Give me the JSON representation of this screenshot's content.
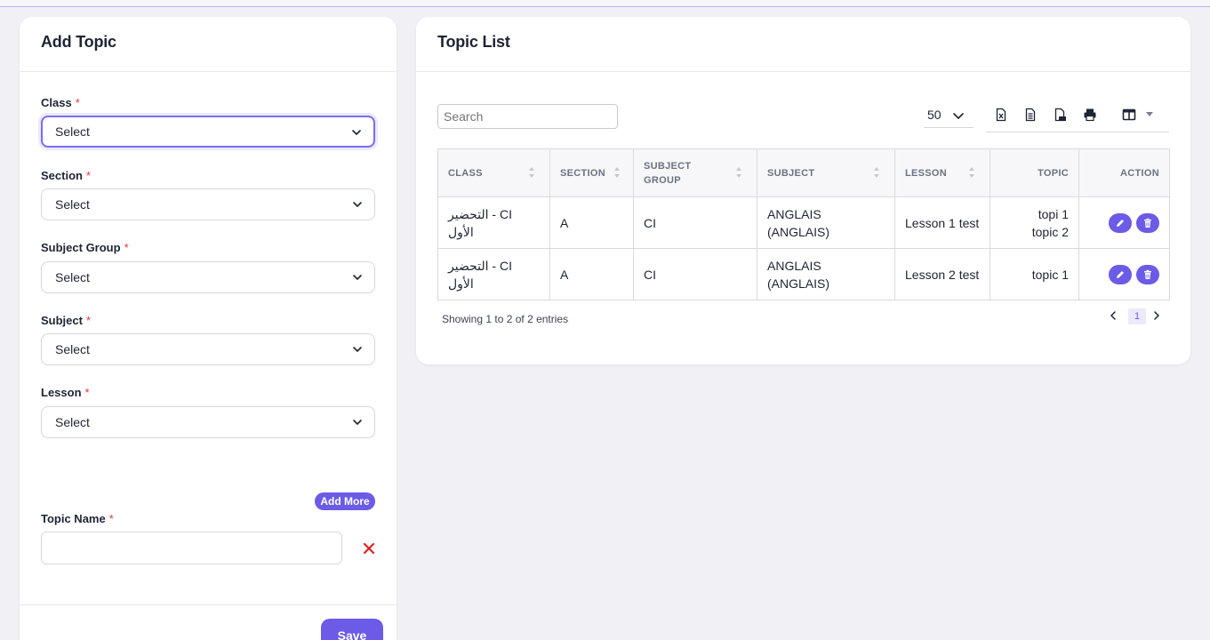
{
  "add_topic": {
    "title": "Add Topic",
    "required_mark": "*",
    "fields": [
      {
        "label": "Class",
        "value": "Select"
      },
      {
        "label": "Section",
        "value": "Select"
      },
      {
        "label": "Subject Group",
        "value": "Select"
      },
      {
        "label": "Subject",
        "value": "Select"
      },
      {
        "label": "Lesson",
        "value": "Select"
      }
    ],
    "add_more_label": "Add More",
    "topic_name_label": "Topic Name",
    "topic_name_value": "",
    "save_label": "Save"
  },
  "topic_list": {
    "title": "Topic List",
    "search_placeholder": "Search",
    "page_size": "50",
    "columns": [
      "CLASS",
      "SECTION",
      "SUBJECT GROUP",
      "SUBJECT",
      "LESSON",
      "TOPIC",
      "ACTION"
    ],
    "rows": [
      {
        "class": "CI - التحضير الأول",
        "section": "A",
        "subject_group": "CI",
        "subject": "ANGLAIS (ANGLAIS)",
        "lesson": "Lesson 1 test",
        "topics": [
          "topi 1",
          "topic 2"
        ]
      },
      {
        "class": "CI - التحضير الأول",
        "section": "A",
        "subject_group": "CI",
        "subject": "ANGLAIS (ANGLAIS)",
        "lesson": "Lesson 2 test",
        "topics": [
          "topic 1"
        ]
      }
    ],
    "info": "Showing 1 to 2 of 2 entries",
    "current_page": "1"
  },
  "icons": {
    "select_chevron": "chevron-down-icon",
    "remove": "close-icon",
    "export": [
      "excel-icon",
      "csv-icon",
      "pdf-icon",
      "print-icon",
      "columns-icon"
    ],
    "row_actions": [
      "pencil-icon",
      "trash-icon"
    ]
  },
  "colors": {
    "accent": "#6b5be6",
    "danger": "#e0334a",
    "remove_x": "#e02020"
  }
}
